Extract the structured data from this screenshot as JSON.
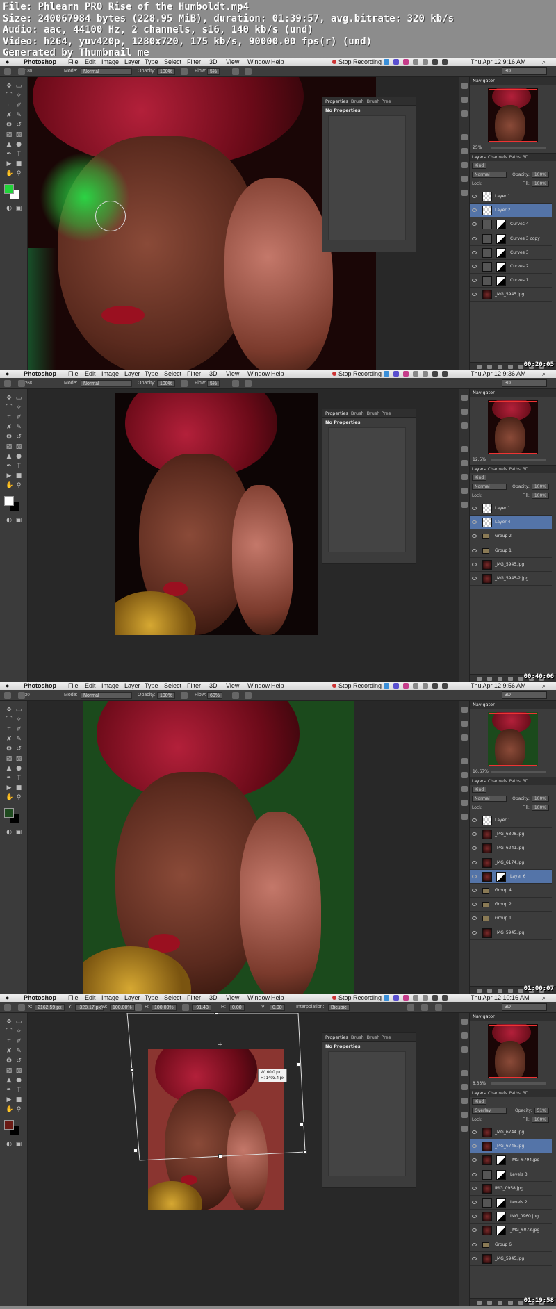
{
  "header": {
    "lines": [
      "File: Phlearn PRO Rise of the Humboldt.mp4",
      "Size: 240067984 bytes (228.95 MiB), duration: 01:39:57, avg.bitrate: 320 kb/s",
      "Audio: aac, 44100 Hz, 2 channels, s16, 140 kb/s (und)",
      "Video: h264, yuv420p, 1280x720, 175 kb/s, 90000.00 fps(r) (und)",
      "Generated by Thumbnail me"
    ]
  },
  "menu": {
    "app": "Photoshop",
    "items": [
      "File",
      "Edit",
      "Image",
      "Layer",
      "Type",
      "Select",
      "Filter",
      "3D",
      "View",
      "Window",
      "Help"
    ],
    "recording": "Stop Recording"
  },
  "frames": [
    {
      "clock": "Thu Apr 12  9:16 AM",
      "timestamp": "00:20:05",
      "options": {
        "mode_label": "Mode:",
        "mode": "Normal",
        "opacity_label": "Opacity:",
        "opacity": "100%",
        "flow_label": "Flow:",
        "flow": "5%",
        "brush_size": "180"
      },
      "workspace": "3D",
      "properties": {
        "tabs": [
          "Properties",
          "Brush",
          "Brush Pres"
        ],
        "title": "No Properties"
      },
      "navigator": {
        "title": "Navigator",
        "zoom": "25%"
      },
      "layers_panel": {
        "tabs": [
          "Layers",
          "Channels",
          "Paths",
          "3D"
        ],
        "kind": "Kind",
        "blend": "Normal",
        "opacity_label": "Opacity:",
        "opacity": "100%",
        "lock_label": "Lock:",
        "fill_label": "Fill:",
        "fill": "100%"
      },
      "layers": [
        {
          "name": "Layer 1",
          "type": "pixel",
          "selected": false
        },
        {
          "name": "Layer 2",
          "type": "pixel",
          "selected": true
        },
        {
          "name": "Curves 4",
          "type": "adjust",
          "selected": false
        },
        {
          "name": "Curves 3 copy",
          "type": "adjust",
          "selected": false
        },
        {
          "name": "Curves 3",
          "type": "adjust",
          "selected": false
        },
        {
          "name": "Curves 2",
          "type": "adjust",
          "selected": false
        },
        {
          "name": "Curves 1",
          "type": "adjust",
          "selected": false
        },
        {
          "name": "_MG_5945.jpg",
          "type": "image",
          "selected": false
        }
      ],
      "colors": {
        "fg": "#22d43a",
        "bg": "#ffffff"
      }
    },
    {
      "clock": "Thu Apr 12  9:36 AM",
      "timestamp": "00:40:06",
      "options": {
        "mode_label": "Mode:",
        "mode": "Normal",
        "opacity_label": "Opacity:",
        "opacity": "100%",
        "flow_label": "Flow:",
        "flow": "5%",
        "brush_size": "268"
      },
      "workspace": "3D",
      "properties": {
        "tabs": [
          "Properties",
          "Brush",
          "Brush Pres"
        ],
        "title": "No Properties"
      },
      "navigator": {
        "title": "Navigator",
        "zoom": "12.5%"
      },
      "layers_panel": {
        "tabs": [
          "Layers",
          "Channels",
          "Paths",
          "3D"
        ],
        "kind": "Kind",
        "blend": "Normal",
        "opacity_label": "Opacity:",
        "opacity": "100%",
        "lock_label": "Lock:",
        "fill_label": "Fill:",
        "fill": "100%"
      },
      "layers": [
        {
          "name": "Layer 1",
          "type": "pixel",
          "selected": false
        },
        {
          "name": "Layer 4",
          "type": "pixel",
          "selected": true
        },
        {
          "name": "Group 2",
          "type": "group",
          "selected": false
        },
        {
          "name": "Group 1",
          "type": "group",
          "selected": false
        },
        {
          "name": "_MG_5945.jpg",
          "type": "image",
          "selected": false
        },
        {
          "name": "_MG_5945-2.jpg",
          "type": "image",
          "selected": false
        }
      ],
      "colors": {
        "fg": "#ffffff",
        "bg": "#000000"
      }
    },
    {
      "clock": "Thu Apr 12  9:56 AM",
      "timestamp": "01:00:07",
      "options": {
        "mode_label": "Mode:",
        "mode": "Normal",
        "opacity_label": "Opacity:",
        "opacity": "100%",
        "flow_label": "Flow:",
        "flow": "60%",
        "brush_size": "20"
      },
      "workspace": "3D",
      "properties": {
        "tabs": [
          "Properties",
          "Brush",
          "Brush Pres"
        ],
        "title": "No Properties"
      },
      "navigator": {
        "title": "Navigator",
        "zoom": "16.67%"
      },
      "layers_panel": {
        "tabs": [
          "Layers",
          "Channels",
          "Paths",
          "3D"
        ],
        "kind": "Kind",
        "blend": "Normal",
        "opacity_label": "Opacity:",
        "opacity": "100%",
        "lock_label": "Lock:",
        "fill_label": "Fill:",
        "fill": "100%"
      },
      "layers": [
        {
          "name": "Layer 1",
          "type": "pixel",
          "selected": false
        },
        {
          "name": "_MG_6308.jpg",
          "type": "image",
          "selected": false
        },
        {
          "name": "_MG_6241.jpg",
          "type": "image",
          "selected": false
        },
        {
          "name": "_MG_6174.jpg",
          "type": "image",
          "selected": false
        },
        {
          "name": "Layer 6",
          "type": "masked",
          "selected": true
        },
        {
          "name": "Group 4",
          "type": "group",
          "selected": false
        },
        {
          "name": "Group 2",
          "type": "group",
          "selected": false
        },
        {
          "name": "Group 1",
          "type": "group",
          "selected": false
        },
        {
          "name": "_MG_5945.jpg",
          "type": "image",
          "selected": false
        }
      ],
      "colors": {
        "fg": "#1f4a1f",
        "bg": "#000000"
      }
    },
    {
      "clock": "Thu Apr 12  10:16 AM",
      "timestamp": "01:19:58",
      "options": {
        "x_label": "X:",
        "x": "2162.59 px",
        "y_label": "Y:",
        "y": "-328.17 px",
        "w_label": "W:",
        "w": "100.00%",
        "h_label": "H:",
        "h": "100.00%",
        "angle": "-91.43",
        "hskew_label": "H:",
        "hskew": "0.00",
        "vskew_label": "V:",
        "vskew": "0.00",
        "interp_label": "Interpolation:",
        "interp": "Bicubic"
      },
      "workspace": "3D",
      "properties": {
        "tabs": [
          "Properties",
          "Brush",
          "Brush Pres"
        ],
        "title": "No Properties"
      },
      "navigator": {
        "title": "Navigator",
        "zoom": "8.33%"
      },
      "transform_readout": {
        "w": "W: 60.0 px",
        "h": "H: 1403.4 px"
      },
      "layers_panel": {
        "tabs": [
          "Layers",
          "Channels",
          "Paths",
          "3D"
        ],
        "kind": "Kind",
        "blend": "Overlay",
        "opacity_label": "Opacity:",
        "opacity": "51%",
        "lock_label": "Lock:",
        "fill_label": "Fill:",
        "fill": "100%"
      },
      "layers": [
        {
          "name": "_MG_6744.jpg",
          "type": "image",
          "selected": false
        },
        {
          "name": "_MG_6745.jpg",
          "type": "image",
          "selected": true
        },
        {
          "name": "_MG_6794.jpg",
          "type": "masked",
          "selected": false
        },
        {
          "name": "Levels 3",
          "type": "adjust",
          "selected": false
        },
        {
          "name": "IMG_0958.jpg",
          "type": "image",
          "selected": false
        },
        {
          "name": "Levels 2",
          "type": "adjust",
          "selected": false
        },
        {
          "name": "IMG_0960.jpg",
          "type": "masked",
          "selected": false
        },
        {
          "name": "_MG_6073.jpg",
          "type": "masked",
          "selected": false
        },
        {
          "name": "Group 6",
          "type": "group",
          "selected": false
        },
        {
          "name": "_MG_5945.jpg",
          "type": "image",
          "selected": false
        }
      ],
      "colors": {
        "fg": "#6a1a14",
        "bg": "#000000"
      }
    }
  ]
}
